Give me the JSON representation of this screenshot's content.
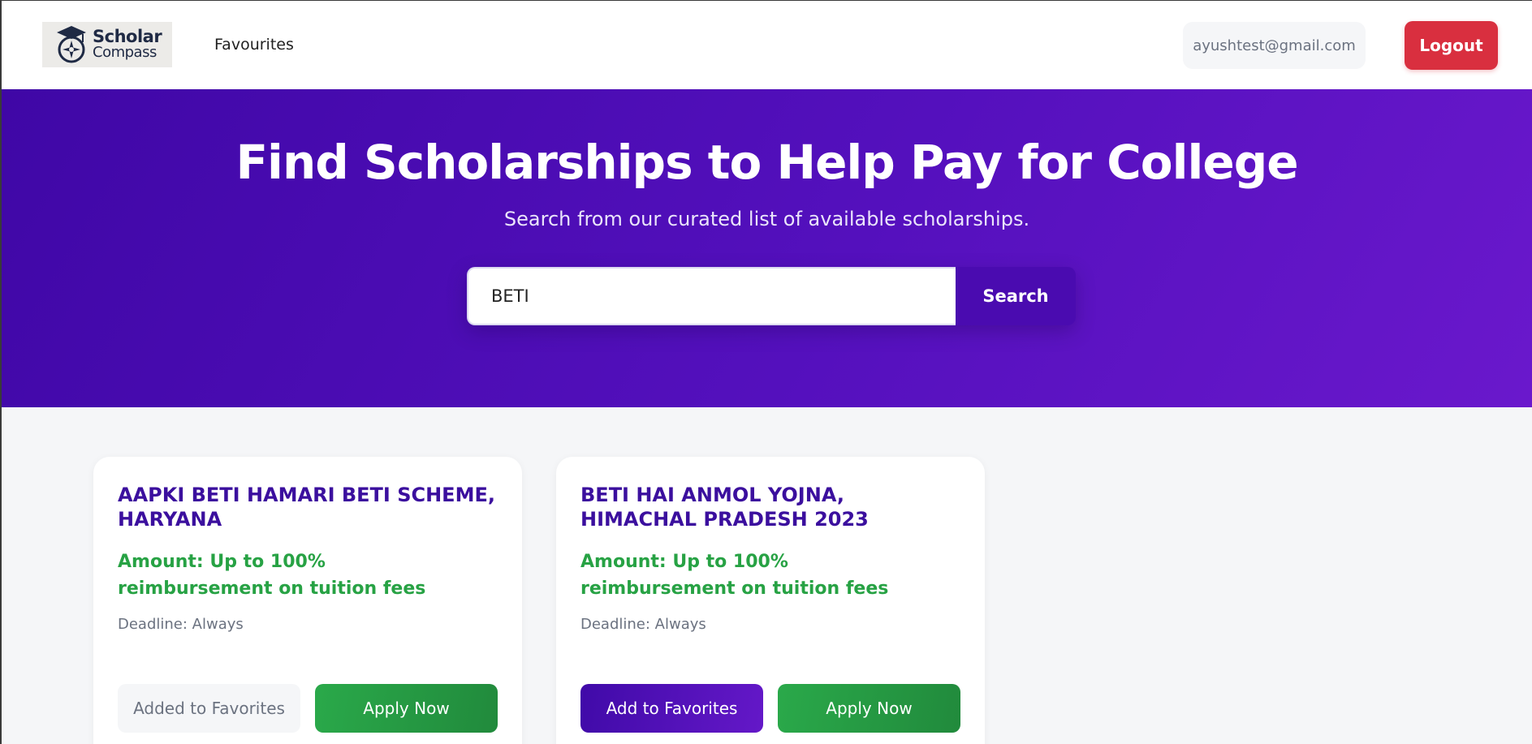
{
  "header": {
    "logo_line1": "Scholar",
    "logo_line2": "Compass",
    "nav_favourites": "Favourites",
    "user_email": "ayushtest@gmail.com",
    "logout_label": "Logout"
  },
  "hero": {
    "title": "Find Scholarships to Help Pay for College",
    "subtitle": "Search from our curated list of available scholarships.",
    "search_value": "BETI",
    "search_button": "Search"
  },
  "scholarships": [
    {
      "title": "AAPKI BETI HAMARI BETI SCHEME, HARYANA",
      "amount": "Amount: Up to 100% reimbursement on tuition fees",
      "deadline": "Deadline: Always",
      "favorite_label": "Added to Favorites",
      "apply_label": "Apply Now"
    },
    {
      "title": "BETI HAI ANMOL YOJNA, HIMACHAL PRADESH 2023",
      "amount": "Amount: Up to 100% reimbursement on tuition fees",
      "deadline": "Deadline: Always",
      "favorite_label": "Add to Favorites",
      "apply_label": "Apply Now"
    }
  ],
  "colors": {
    "brand_purple": "#4a0bb0",
    "logout_red": "#d92f3f",
    "apply_green": "#27a244"
  }
}
